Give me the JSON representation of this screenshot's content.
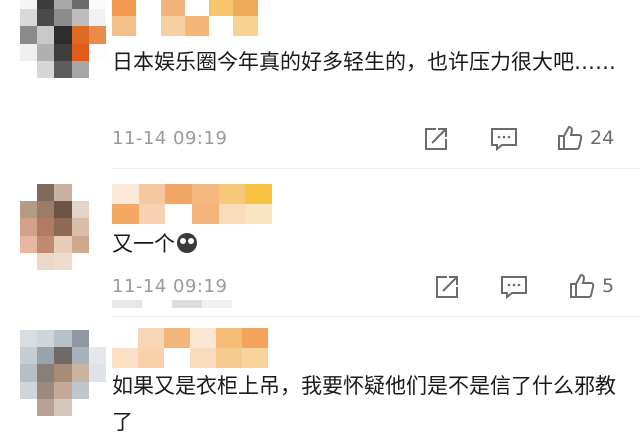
{
  "comments": [
    {
      "text": "日本娱乐圈今年真的好多轻生的，也许压力很大吧……",
      "time": "11-14 09:19",
      "likes": "24",
      "icons": {
        "share": "share-arrow-icon",
        "comment": "comment-bubble-icon",
        "like": "thumbs-up-icon"
      }
    },
    {
      "text": "又一个",
      "emoji": "crying-face-emoji",
      "time": "11-14 09:19",
      "likes": "5",
      "icons": {
        "share": "share-arrow-icon",
        "comment": "comment-bubble-icon",
        "like": "thumbs-up-icon"
      }
    },
    {
      "text": "如果又是衣柜上吊，我要怀疑他们是不是信了什么邪教了"
    }
  ],
  "colors": {
    "text": "#1a1a1a",
    "meta": "#9a9a9a",
    "icon": "#6b6b6b",
    "mosaic_orange": "#f4a35a",
    "mosaic_yellow": "#f6c343"
  }
}
